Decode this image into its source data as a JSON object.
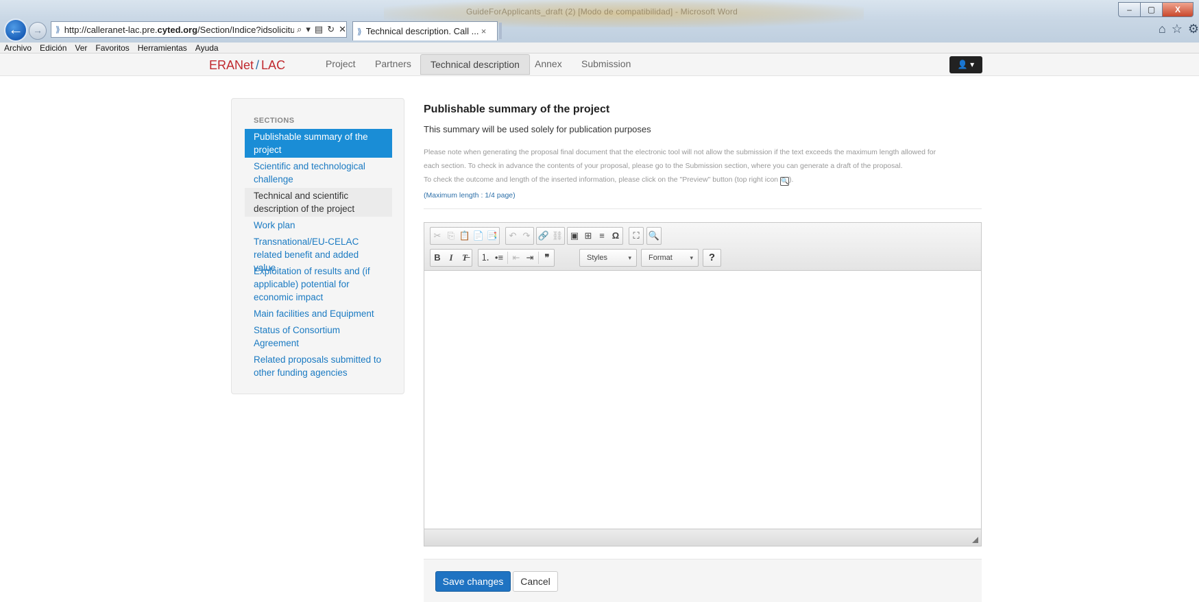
{
  "browser": {
    "window_title": "GuideForApplicants_draft (2) [Modo de compatibilidad] - Microsoft Word",
    "url_prefix": "http://calleranet-lac.pre.",
    "url_domain": "cyted.org",
    "url_path": "/Section/Indice?idsolicitud=8Voc",
    "tab_title": "Technical description. Call ...",
    "tab_close": "×",
    "menu": [
      "Archivo",
      "Edición",
      "Ver",
      "Favoritos",
      "Herramientas",
      "Ayuda"
    ],
    "window_controls": {
      "minimize": "–",
      "maximize": "▢",
      "close": "X"
    }
  },
  "navbar": {
    "brand_left": "ERANet",
    "brand_slash": "/",
    "brand_right": "LAC",
    "items": [
      "Project",
      "Partners",
      "Technical description",
      "Annex",
      "Submission"
    ],
    "active": "Technical description",
    "user_button": "👤 ▾"
  },
  "sidebar": {
    "title": "SECTIONS",
    "items": [
      "Publishable summary of the project",
      "Scientific and technological challenge",
      "Technical and scientific description of the project",
      "Work plan",
      "Transnational/EU-CELAC related benefit and added value",
      "Exploitation of results and (if applicable) potential for economic impact",
      "Main facilities and Equipment",
      "Status of Consortium Agreement",
      "Related proposals submitted to other funding agencies"
    ],
    "active_index": 0
  },
  "main": {
    "title": "Publishable summary of the project",
    "subtitle": "This summary will be used solely for publication purposes",
    "notice_line1": "Please note when generating the proposal final document that the electronic tool will not allow the submission if the text exceeds the maximum length allowed for",
    "notice_line2": "each section. To check in advance the contents of your proposal, please go to the Submission section, where you can generate a draft of the proposal.",
    "notice_line3_a": "To check the outcome and length of the inserted information, please click on the \"Preview\" button (top right icon",
    "notice_line3_b": ").",
    "max_length": "(Maximum length : 1/4 page)"
  },
  "editor": {
    "styles_label": "Styles",
    "format_label": "Format",
    "help_label": "?",
    "content": ""
  },
  "actions": {
    "save_label": "Save changes",
    "cancel_label": "Cancel"
  }
}
